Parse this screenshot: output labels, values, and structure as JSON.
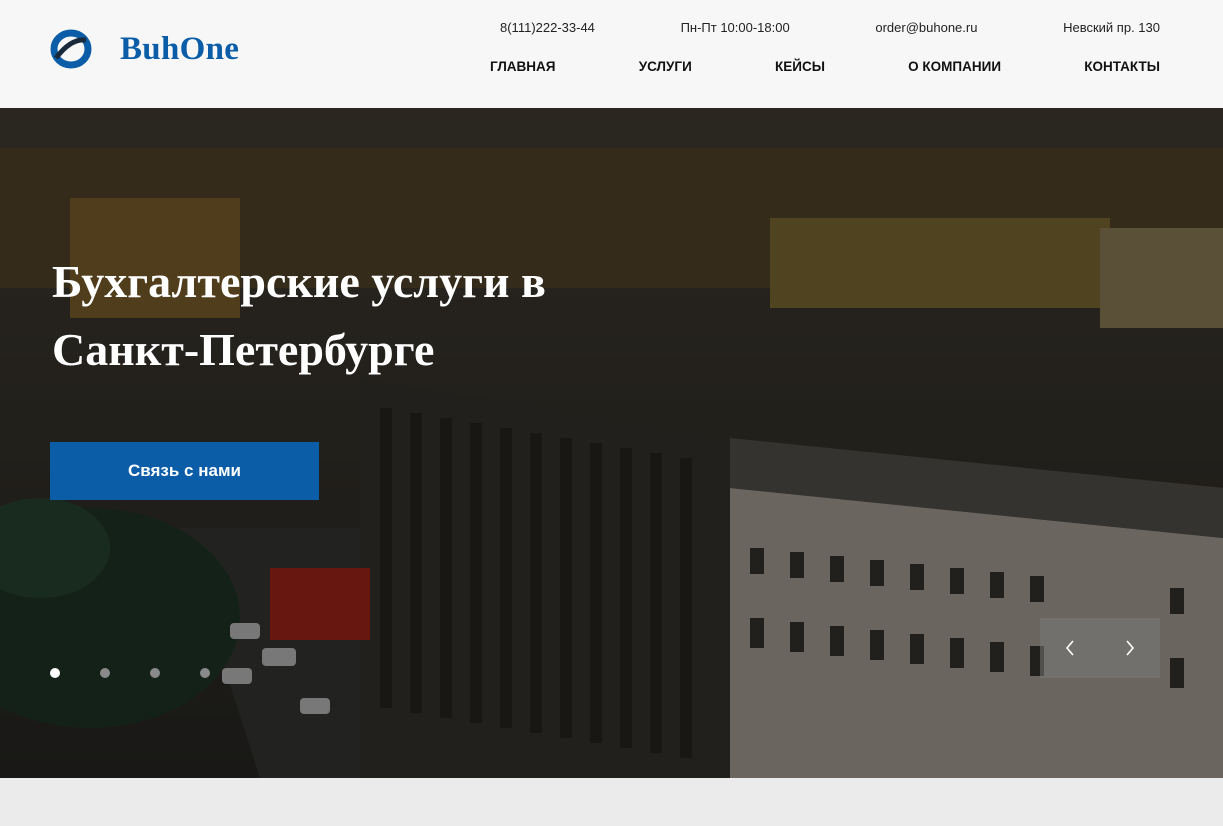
{
  "brand": {
    "name": "BuhOne",
    "color": "#0a5da6"
  },
  "contacts": {
    "phone": "8(111)222-33-44",
    "hours": "Пн-Пт 10:00-18:00",
    "email": "order@buhone.ru",
    "address": "Невский пр. 130"
  },
  "nav": {
    "items": [
      {
        "label": "ГЛАВНАЯ"
      },
      {
        "label": "УСЛУГИ"
      },
      {
        "label": "КЕЙСЫ"
      },
      {
        "label": "О КОМПАНИИ"
      },
      {
        "label": "КОНТАКТЫ"
      }
    ]
  },
  "hero": {
    "title": "Бухгалтерские услуги в Санкт-Петербурге",
    "cta_label": "Связь с нами",
    "slides_count": 4,
    "active_slide": 1,
    "prev_icon": "chevron-left-icon",
    "next_icon": "chevron-right-icon"
  }
}
